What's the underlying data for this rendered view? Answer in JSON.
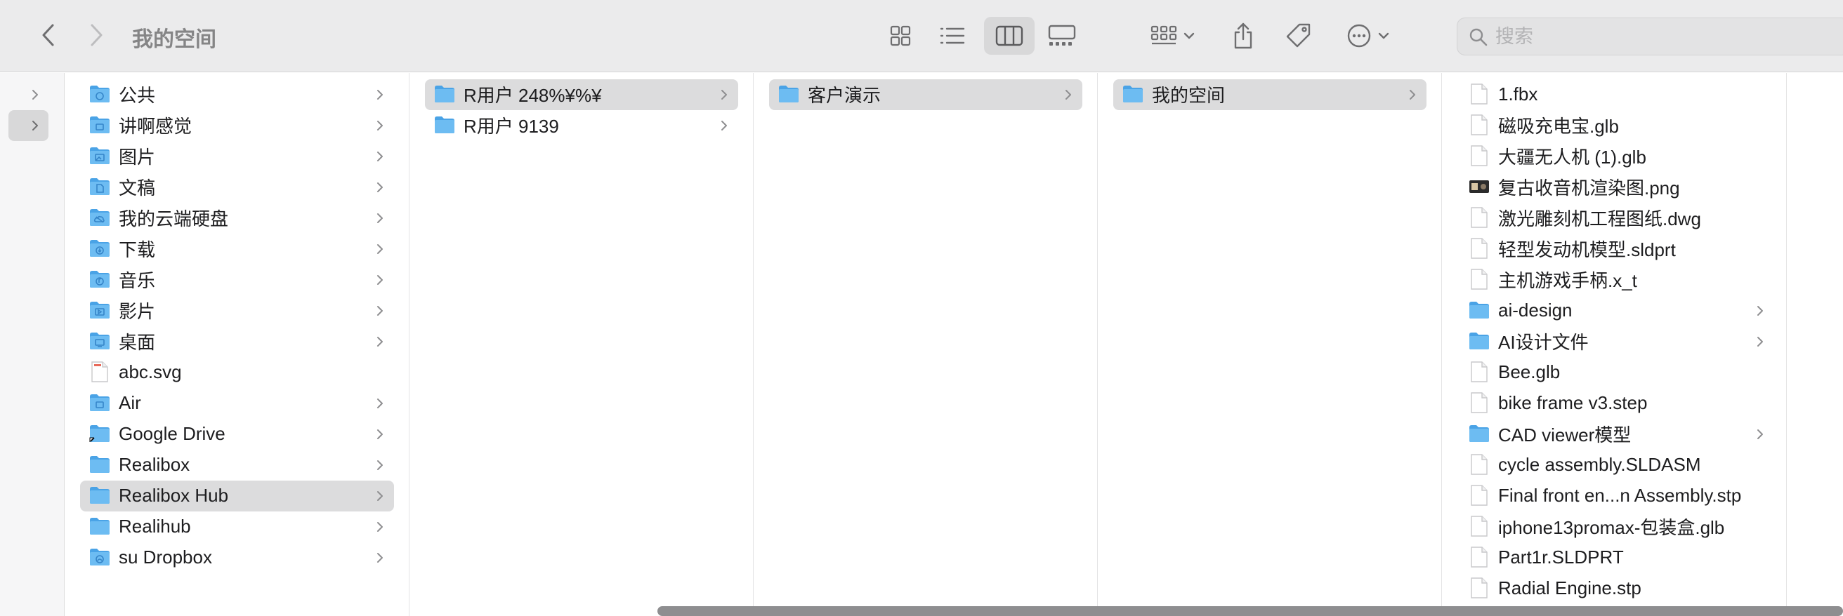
{
  "window": {
    "title": "我的空间"
  },
  "search": {
    "placeholder": "搜索",
    "value": ""
  },
  "sidebar_column": {
    "items": [
      {
        "selected": false
      },
      {
        "selected": true
      }
    ]
  },
  "column1": {
    "items": [
      {
        "label": "公共",
        "icon": "folder-public-icon",
        "has_children": true,
        "selected": false
      },
      {
        "label": "讲啊感觉",
        "icon": "folder-generic-icon",
        "has_children": true,
        "selected": false
      },
      {
        "label": "图片",
        "icon": "folder-pictures-icon",
        "has_children": true,
        "selected": false
      },
      {
        "label": "文稿",
        "icon": "folder-documents-icon",
        "has_children": true,
        "selected": false
      },
      {
        "label": "我的云端硬盘",
        "icon": "folder-cloud-icon",
        "has_children": true,
        "selected": false
      },
      {
        "label": "下载",
        "icon": "folder-downloads-icon",
        "has_children": true,
        "selected": false
      },
      {
        "label": "音乐",
        "icon": "folder-music-icon",
        "has_children": true,
        "selected": false
      },
      {
        "label": "影片",
        "icon": "folder-movies-icon",
        "has_children": true,
        "selected": false
      },
      {
        "label": "桌面",
        "icon": "folder-desktop-icon",
        "has_children": true,
        "selected": false
      },
      {
        "label": "abc.svg",
        "icon": "svg-file-icon",
        "has_children": false,
        "selected": false
      },
      {
        "label": "Air",
        "icon": "folder-generic-icon",
        "has_children": true,
        "selected": false
      },
      {
        "label": "Google Drive",
        "icon": "folder-alias-icon",
        "has_children": true,
        "selected": false
      },
      {
        "label": "Realibox",
        "icon": "folder-icon",
        "has_children": true,
        "selected": false
      },
      {
        "label": "Realibox Hub",
        "icon": "folder-icon",
        "has_children": true,
        "selected": true
      },
      {
        "label": "Realihub",
        "icon": "folder-icon",
        "has_children": true,
        "selected": false
      },
      {
        "label": "su Dropbox",
        "icon": "folder-shared-icon",
        "has_children": true,
        "selected": false
      }
    ]
  },
  "column2": {
    "items": [
      {
        "label": "R用户 248%¥%¥",
        "icon": "folder-icon",
        "has_children": true,
        "selected": true
      },
      {
        "label": "R用户 9139",
        "icon": "folder-icon",
        "has_children": true,
        "selected": false
      }
    ]
  },
  "column3": {
    "items": [
      {
        "label": "客户演示",
        "icon": "folder-icon",
        "has_children": true,
        "selected": true
      }
    ]
  },
  "column4": {
    "items": [
      {
        "label": "我的空间",
        "icon": "folder-icon",
        "has_children": true,
        "selected": true
      }
    ]
  },
  "column5": {
    "items": [
      {
        "label": "1.fbx",
        "icon": "document-icon",
        "has_children": false
      },
      {
        "label": "磁吸充电宝.glb",
        "icon": "document-icon",
        "has_children": false
      },
      {
        "label": "大疆无人机 (1).glb",
        "icon": "document-icon",
        "has_children": false
      },
      {
        "label": "复古收音机渲染图.png",
        "icon": "image-thumbnail-icon",
        "has_children": false
      },
      {
        "label": "激光雕刻机工程图纸.dwg",
        "icon": "document-icon",
        "has_children": false
      },
      {
        "label": "轻型发动机模型.sldprt",
        "icon": "document-icon",
        "has_children": false
      },
      {
        "label": "主机游戏手柄.x_t",
        "icon": "document-icon",
        "has_children": false
      },
      {
        "label": "ai-design",
        "icon": "folder-icon",
        "has_children": true
      },
      {
        "label": "AI设计文件",
        "icon": "folder-icon",
        "has_children": true
      },
      {
        "label": "Bee.glb",
        "icon": "document-icon",
        "has_children": false
      },
      {
        "label": "bike frame v3.step",
        "icon": "document-icon",
        "has_children": false
      },
      {
        "label": "CAD viewer模型",
        "icon": "folder-icon",
        "has_children": true
      },
      {
        "label": "cycle assembly.SLDASM",
        "icon": "document-icon",
        "has_children": false
      },
      {
        "label": "Final front en...n Assembly.stp",
        "icon": "document-icon",
        "has_children": false
      },
      {
        "label": "iphone13promax-包装盒.glb",
        "icon": "document-icon",
        "has_children": false
      },
      {
        "label": "Part1r.SLDPRT",
        "icon": "document-icon",
        "has_children": false
      },
      {
        "label": "Radial Engine.stp",
        "icon": "document-icon",
        "has_children": false
      }
    ]
  },
  "colors": {
    "toolbar_bg": "#ebebec",
    "selection": "#dcdcdd",
    "folder_blue": "#5fb4ef",
    "text": "#1d1d1f"
  }
}
